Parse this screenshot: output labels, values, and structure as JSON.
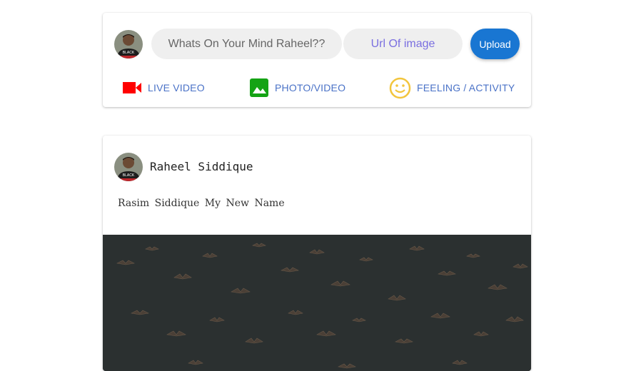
{
  "composer": {
    "status_placeholder": "Whats On Your Mind Raheel??",
    "url_placeholder": "Url Of image",
    "upload_label": "Upload",
    "actions": [
      {
        "label": "LIVE VIDEO",
        "icon": "video-camera-icon",
        "color": "#ff0000"
      },
      {
        "label": "PHOTO/VIDEO",
        "icon": "photo-icon",
        "color": "#14a314"
      },
      {
        "label": "FEELING / ACTIVITY",
        "icon": "smiley-icon",
        "color": "#f2c53d"
      }
    ]
  },
  "post": {
    "author": "Raheel Siddique",
    "text": "Rasim Siddique My New Name"
  },
  "colors": {
    "accent": "#1976d2",
    "action_text": "#4a72c7"
  }
}
